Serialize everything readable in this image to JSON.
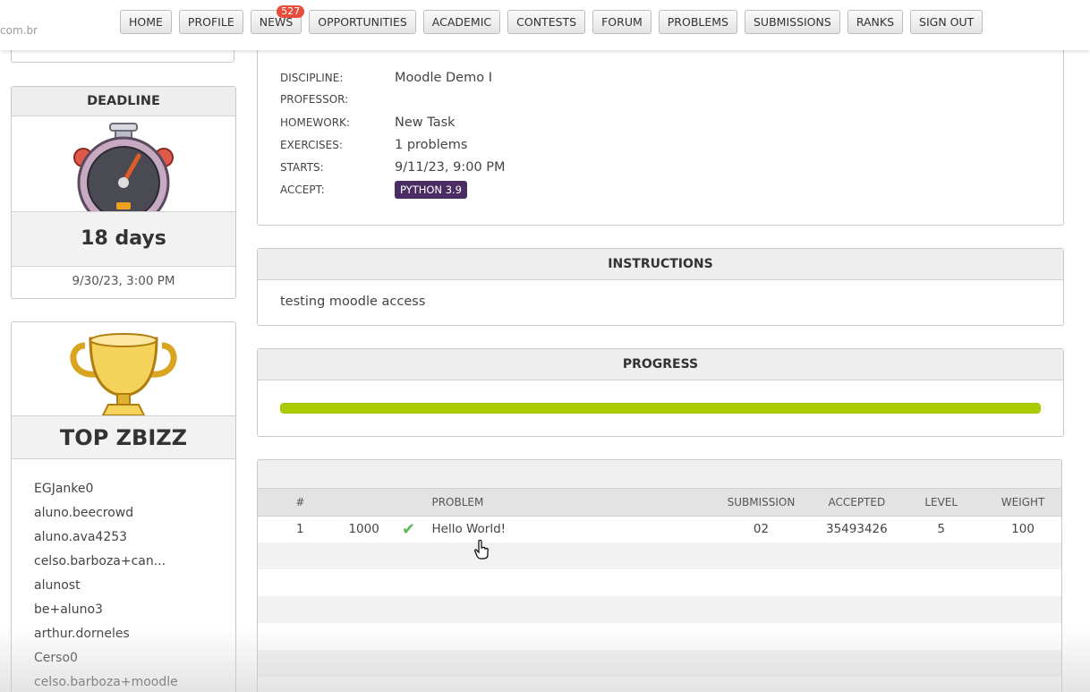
{
  "site": {
    "url_fragment": "com.br"
  },
  "nav": {
    "items": [
      {
        "label": "HOME"
      },
      {
        "label": "PROFILE"
      },
      {
        "label": "NEWS",
        "badge": "527"
      },
      {
        "label": "OPPORTUNITIES"
      },
      {
        "label": "ACADEMIC"
      },
      {
        "label": "CONTESTS"
      },
      {
        "label": "FORUM"
      },
      {
        "label": "PROBLEMS"
      },
      {
        "label": "SUBMISSIONS"
      },
      {
        "label": "RANKS"
      },
      {
        "label": "SIGN OUT"
      }
    ]
  },
  "deadline": {
    "title": "DEADLINE",
    "icon": "stopwatch-icon",
    "remaining": "18 days",
    "date": "9/30/23, 3:00 PM"
  },
  "ranking": {
    "icon": "trophy-icon",
    "title": "TOP ZBIZZ",
    "users": [
      "EGJanke0",
      "aluno.beecrowd",
      "aluno.ava4253",
      "celso.barboza+can...",
      "alunost",
      "be+aluno3",
      "arthur.dorneles",
      "Cerso0",
      "celso.barboza+moodle"
    ]
  },
  "homework": {
    "fields": [
      {
        "label": "DISCIPLINE:",
        "value": "Moodle Demo I"
      },
      {
        "label": "PROFESSOR:",
        "value": ""
      },
      {
        "label": "HOMEWORK:",
        "value": "New Task"
      },
      {
        "label": "EXERCISES:",
        "value": "1 problems"
      },
      {
        "label": "STARTS:",
        "value": "9/11/23, 9:00 PM"
      }
    ],
    "accept_label": "ACCEPT:",
    "accept_language": "PYTHON 3.9"
  },
  "instructions": {
    "title": "INSTRUCTIONS",
    "text": "testing moodle access"
  },
  "progress": {
    "title": "PROGRESS",
    "percent": 100,
    "color": "#a8cc00"
  },
  "problems_table": {
    "columns": [
      "#",
      "",
      "",
      "PROBLEM",
      "SUBMISSION",
      "ACCEPTED",
      "LEVEL",
      "WEIGHT"
    ],
    "rows": [
      {
        "num": "1",
        "id": "1000",
        "status_icon": "check-icon",
        "problem": "Hello World!",
        "submission": "02",
        "accepted": "35493426",
        "level": "5",
        "weight": "100"
      }
    ]
  },
  "colors": {
    "accent_purple": "#4a2d62",
    "success_green": "#5cb85c",
    "badge_red": "#e74c3c"
  }
}
